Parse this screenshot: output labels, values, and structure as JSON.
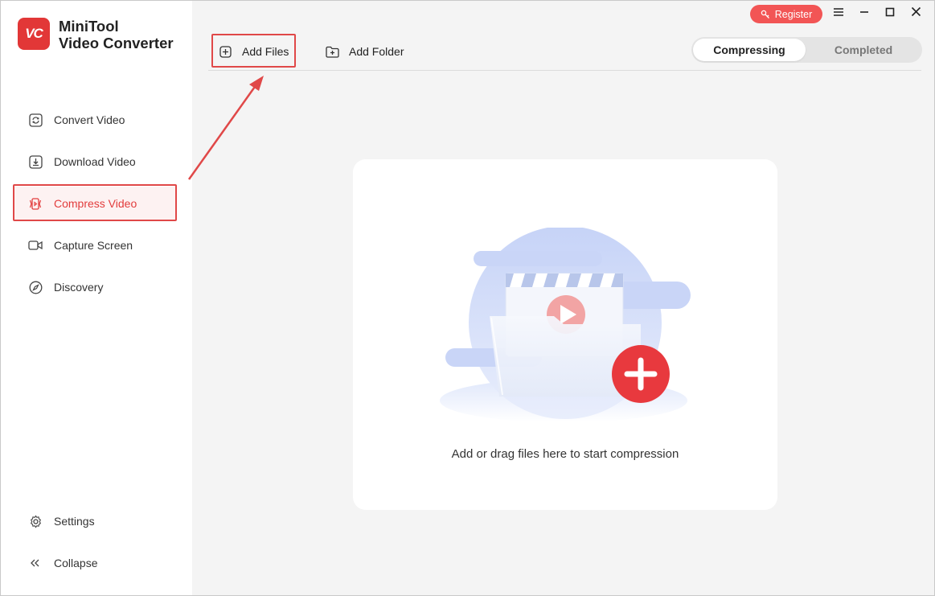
{
  "app": {
    "logo_text": "VC",
    "name_line1": "MiniTool",
    "name_line2": "Video Converter"
  },
  "sidebar": {
    "items": [
      {
        "label": "Convert Video",
        "icon": "convert-icon"
      },
      {
        "label": "Download Video",
        "icon": "download-icon"
      },
      {
        "label": "Compress Video",
        "icon": "compress-icon",
        "active": true
      },
      {
        "label": "Capture Screen",
        "icon": "camera-icon"
      },
      {
        "label": "Discovery",
        "icon": "compass-icon"
      }
    ],
    "settings_label": "Settings",
    "collapse_label": "Collapse"
  },
  "toolbar": {
    "add_files_label": "Add Files",
    "add_folder_label": "Add Folder"
  },
  "tabs": {
    "compressing_label": "Compressing",
    "completed_label": "Completed",
    "active": "compressing"
  },
  "titlebar": {
    "register_label": "Register"
  },
  "dropzone": {
    "hint": "Add or drag files here to start compression"
  },
  "colors": {
    "accent": "#e23c3c",
    "register": "#f25555",
    "logo": "#e23737"
  }
}
